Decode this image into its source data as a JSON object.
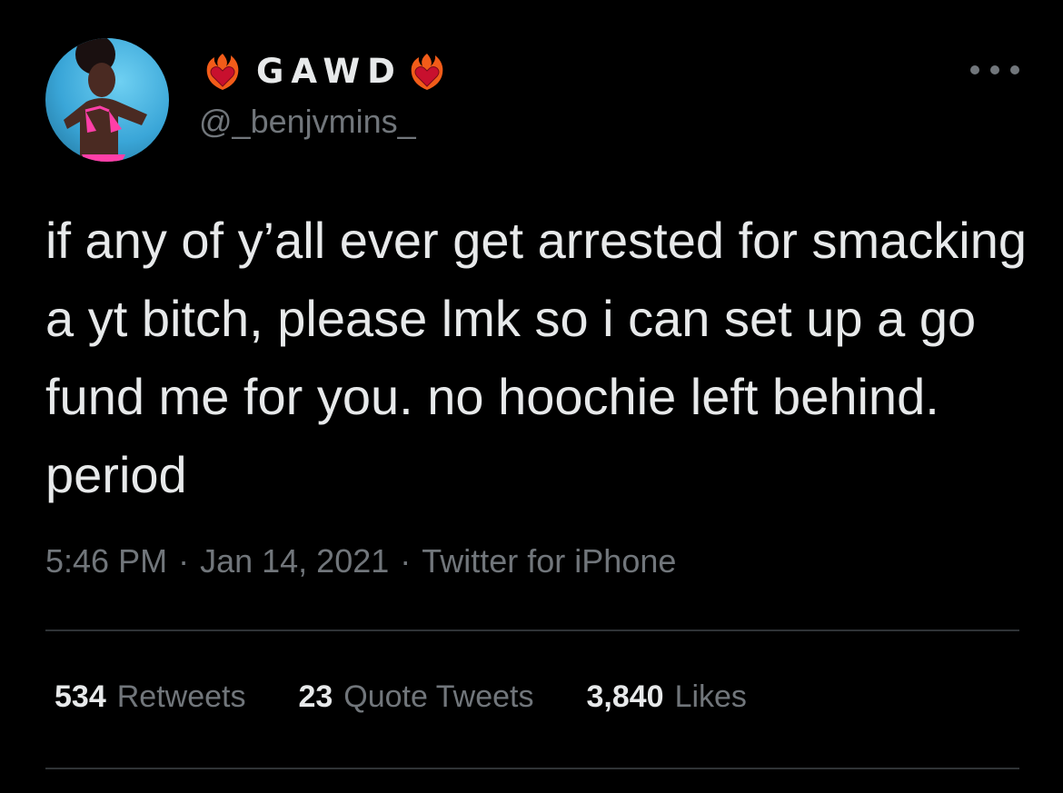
{
  "author": {
    "display_name": "GAWD",
    "handle": "@_benjvmins_",
    "name_emoji_icon": "fire-heart-icon"
  },
  "tweet": {
    "text": "if any of y’all ever get arrested for smacking a yt bitch, please lmk so i can set up a go fund me for you. no hoochie left behind. period",
    "time": "5:46 PM",
    "date": "Jan 14, 2021",
    "source": "Twitter for iPhone",
    "separator": "·"
  },
  "stats": {
    "retweets": {
      "count": "534",
      "label": "Retweets"
    },
    "quotes": {
      "count": "23",
      "label": "Quote Tweets"
    },
    "likes": {
      "count": "3,840",
      "label": "Likes"
    }
  },
  "colors": {
    "background": "#000000",
    "primary_text": "#e7e9ea",
    "secondary_text": "#71767b",
    "divider": "#2f3336"
  }
}
